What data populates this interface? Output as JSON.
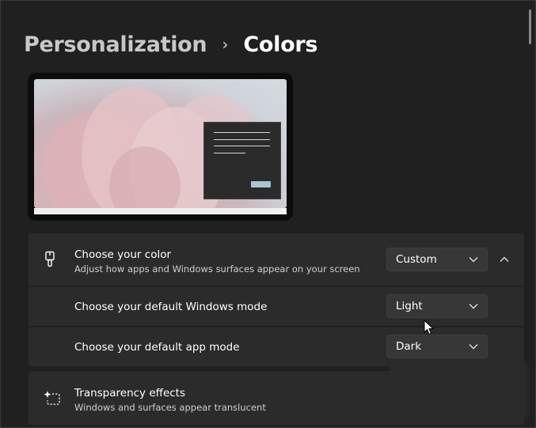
{
  "breadcrumb": {
    "parent": "Personalization",
    "separator": "›",
    "current": "Colors"
  },
  "preview": {
    "accent": "#a9c6d2",
    "window_bg": "#2b2b2b"
  },
  "color_settings": {
    "choose_color": {
      "title": "Choose your color",
      "description": "Adjust how apps and Windows surfaces appear on your screen",
      "value": "Custom",
      "icon": "paintbrush-icon"
    },
    "windows_mode": {
      "title": "Choose your default Windows mode",
      "value": "Light"
    },
    "app_mode": {
      "title": "Choose your default app mode",
      "value": "Dark"
    }
  },
  "transparency": {
    "title": "Transparency effects",
    "description": "Windows and surfaces appear translucent",
    "icon": "sparkle-icon"
  },
  "theme": {
    "background": "#202020",
    "card": "#2b2b2b",
    "control": "#373737"
  }
}
